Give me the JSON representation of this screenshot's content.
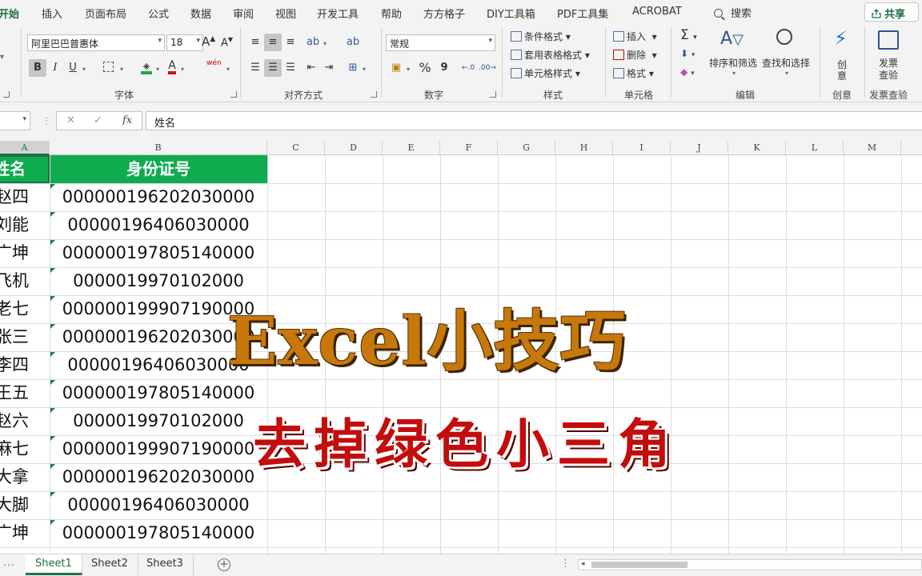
{
  "menu": {
    "tabs": [
      "开始",
      "插入",
      "页面布局",
      "公式",
      "数据",
      "审阅",
      "视图",
      "开发工具",
      "帮助",
      "方方格子",
      "DIY工具箱",
      "PDF工具集",
      "ACROBAT"
    ],
    "search": "搜索",
    "share": "共享"
  },
  "ribbon": {
    "font": {
      "name": "阿里巴巴普惠体",
      "size": "18",
      "grow": "A",
      "shrink": "A",
      "bold": "B",
      "italic": "I",
      "underline": "U",
      "font_color_letter": "A",
      "phonetic": "wén",
      "group_label": "字体"
    },
    "alignment": {
      "group_label": "对齐方式"
    },
    "number": {
      "format": "常规",
      "percent": "%",
      "comma": "9",
      "group_label": "数字"
    },
    "styles": {
      "conditional": "条件格式",
      "table_format": "套用表格格式",
      "cell_style": "单元格样式",
      "group_label": "样式"
    },
    "cells": {
      "insert": "插入",
      "delete": "删除",
      "format": "格式",
      "group_label": "单元格"
    },
    "editing": {
      "sort_filter": "排序和筛选",
      "find_select": "查找和选择",
      "sigma": "Σ",
      "group_label": "编辑"
    },
    "creative": {
      "label_line1": "创",
      "label_line2": "意",
      "group_label": "创意"
    },
    "invoice": {
      "label_line1": "发票",
      "label_line2": "查验",
      "group_label": "发票查验"
    }
  },
  "formula_bar": {
    "fx": "fx",
    "value": "姓名"
  },
  "columns": [
    "A",
    "B",
    "C",
    "D",
    "E",
    "F",
    "G",
    "H",
    "I",
    "J",
    "K",
    "L",
    "M"
  ],
  "table": {
    "header": {
      "name": "姓名",
      "id": "身份证号"
    },
    "rows": [
      {
        "name": "赵四",
        "id": "000000196202030000"
      },
      {
        "name": "刘能",
        "id": "00000196406030000"
      },
      {
        "name": "广坤",
        "id": "000000197805140000"
      },
      {
        "name": "飞机",
        "id": "0000019970102000"
      },
      {
        "name": "老七",
        "id": "000000199907190000"
      },
      {
        "name": "张三",
        "id": "000000196202030000"
      },
      {
        "name": "李四",
        "id": "00000196406030000"
      },
      {
        "name": "王五",
        "id": "000000197805140000"
      },
      {
        "name": "赵六",
        "id": "0000019970102000"
      },
      {
        "name": "麻七",
        "id": "000000199907190000"
      },
      {
        "name": "大拿",
        "id": "000000196202030000"
      },
      {
        "name": "大脚",
        "id": "00000196406030000"
      },
      {
        "name": "广坤",
        "id": "000000197805140000"
      }
    ]
  },
  "overlay": {
    "title": "Excel小技巧",
    "subtitle": "去掉绿色小三角"
  },
  "sheets": [
    "Sheet1",
    "Sheet2",
    "Sheet3"
  ],
  "colors": {
    "accent": "#1e7145",
    "header_fill": "#0fac4f",
    "title_color": "#c8780b",
    "subtitle_color": "#c40c0c"
  }
}
